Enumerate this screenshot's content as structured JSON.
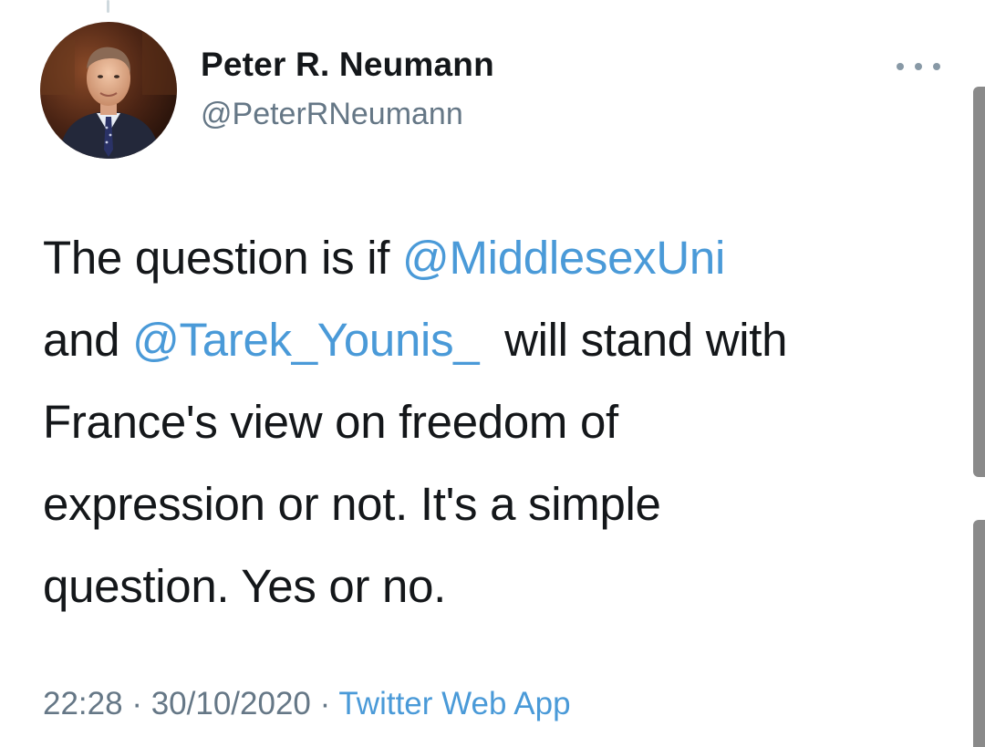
{
  "author": {
    "name": "Peter R. Neumann",
    "handle": "@PeterRNeumann"
  },
  "tweet": {
    "line1_text": "The question is if ",
    "mention1": "@MiddlesexUni",
    "line2_text_before": "and ",
    "mention2": "@Tarek_Younis_",
    "line2_text_after": "  will stand with",
    "line3": "France's view on freedom of",
    "line4": "expression or not. It's a simple",
    "line5": "question. Yes or no."
  },
  "meta": {
    "time": "22:28",
    "separator1": " · ",
    "date": "30/10/2020",
    "separator2": " · ",
    "source": "Twitter Web App"
  },
  "colors": {
    "link": "#4a9ad8",
    "text": "#14171a",
    "secondary": "#657786"
  },
  "icons": {
    "more": "more-horizontal-icon"
  }
}
